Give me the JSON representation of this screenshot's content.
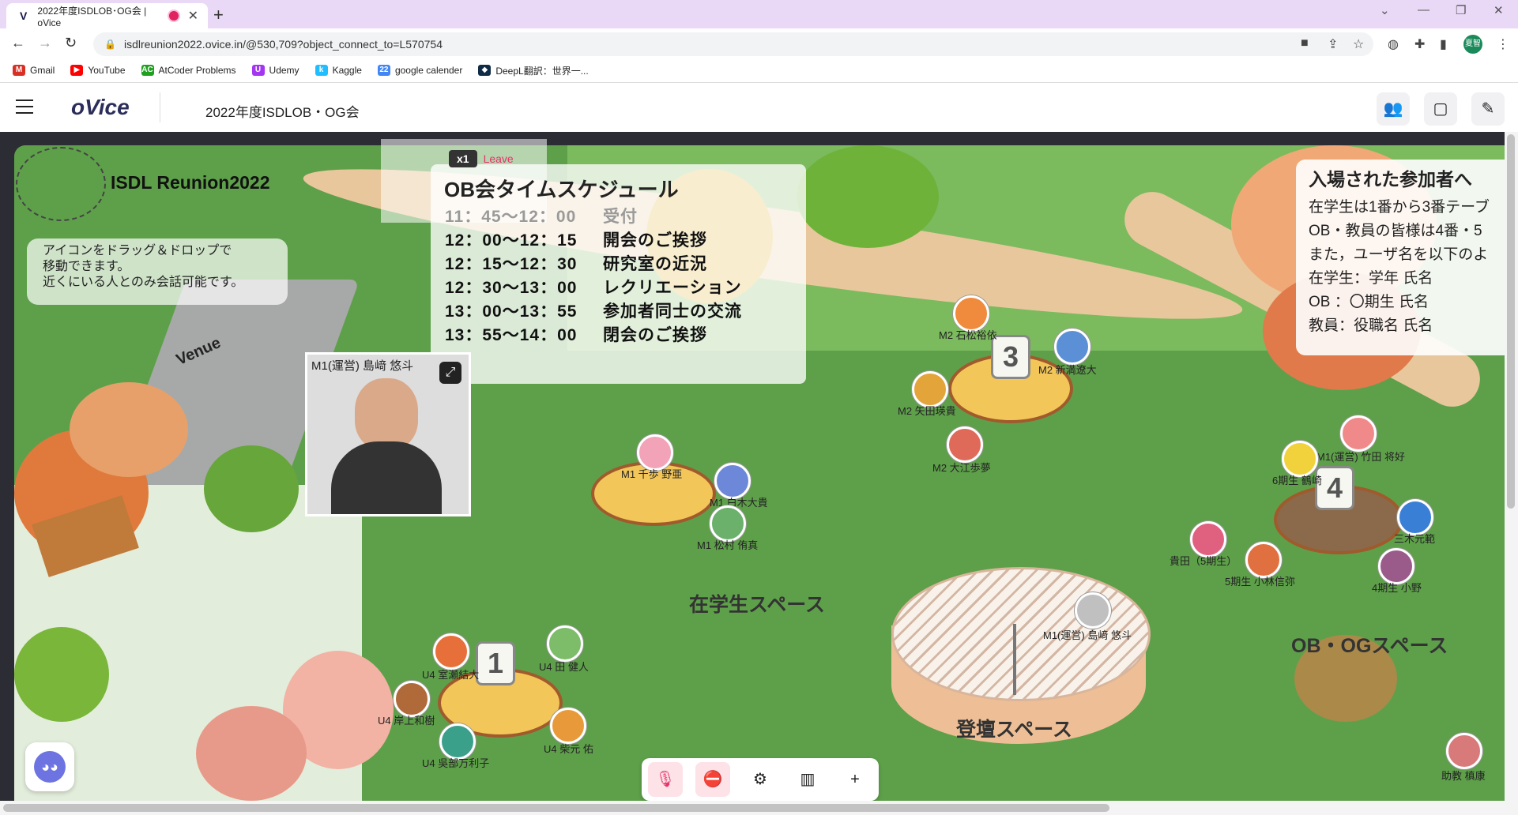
{
  "browser": {
    "tab_title": "2022年度ISDLOB･OG会 | oVice",
    "tab_favicon": "V",
    "new_tab": "+",
    "close_tab": "✕",
    "url": "isdlreunion2022.ovice.in/@530,709?object_connect_to=L570754",
    "bookmarks": [
      {
        "label": "Gmail",
        "icon": "M",
        "color": "#d93025"
      },
      {
        "label": "YouTube",
        "icon": "▶",
        "color": "#ff0000"
      },
      {
        "label": "AtCoder Problems",
        "icon": "AC",
        "color": "#1fa11f"
      },
      {
        "label": "Udemy",
        "icon": "U",
        "color": "#a435f0"
      },
      {
        "label": "Kaggle",
        "icon": "k",
        "color": "#20beff"
      },
      {
        "label": "google calender",
        "icon": "22",
        "color": "#4285f4"
      },
      {
        "label": "DeepL翻訳：世界一...",
        "icon": "◆",
        "color": "#0f2b46"
      }
    ],
    "profile_initials": "夏智"
  },
  "app": {
    "logo": "oVice",
    "room_title": "2022年度ISDLOB・OG会"
  },
  "map": {
    "isdl_title": "ISDL Reunion2022",
    "instructions": [
      "アイコンをドラッグ＆ドロップで",
      "移動できます。",
      "近くにいる人とのみ会話可能です。"
    ],
    "venue_sign": "Venue",
    "zoom": "x1",
    "leave": "Leave",
    "schedule_title": "OB会タイムスケジュール",
    "schedule": [
      {
        "time": "11：45〜12：00",
        "item": "受付"
      },
      {
        "time": "12：00〜12：15",
        "item": "開会のご挨拶"
      },
      {
        "time": "12：15〜12：30",
        "item": "研究室の近況"
      },
      {
        "time": "12：30〜13：00",
        "item": "レクリエーション"
      },
      {
        "time": "13：00〜13：55",
        "item": "参加者同士の交流"
      },
      {
        "time": "13：55〜14：00",
        "item": "閉会のご挨拶"
      }
    ],
    "notice_title": "入場された参加者へ",
    "notice_lines": [
      "在学生は1番から3番テーブ",
      "OB・教員の皆様は4番・5",
      "また，ユーザ名を以下のよ",
      "在学生：学年 氏名",
      "OB ：〇期生 氏名",
      "教員：役職名 氏名"
    ],
    "video_label": "M1(運営) 島﨑 悠斗",
    "space_labels": {
      "students": "在学生スペース",
      "obog": "OB・OGスペース",
      "stage": "登壇スペース"
    },
    "tables": [
      "1",
      "3",
      "4"
    ],
    "users": [
      {
        "name": "M2 石松裕依",
        "color": "#f08a3c"
      },
      {
        "name": "M2 新満遼大",
        "color": "#5b8fd6"
      },
      {
        "name": "M2 矢田瑛貴",
        "color": "#e3a43a"
      },
      {
        "name": "M2 大江歩夢",
        "color": "#e06a5a"
      },
      {
        "name": "M1 千歩 野亜",
        "color": "#f3a3b8"
      },
      {
        "name": "M1 白木大貴",
        "color": "#6d88d8"
      },
      {
        "name": "M1 松村 侑真",
        "color": "#6bb06b"
      },
      {
        "name": "U4 室瀬結大",
        "color": "#e66f3a"
      },
      {
        "name": "U4 田 健人",
        "color": "#7dbd6a"
      },
      {
        "name": "U4 岸上和樹",
        "color": "#b06a3a"
      },
      {
        "name": "U4 柴元 佑",
        "color": "#e89a3a"
      },
      {
        "name": "U4 吳部万利子",
        "color": "#3aa08a"
      },
      {
        "name": "M1(運営) 竹田 将好",
        "color": "#f08a8a"
      },
      {
        "name": "6期生 鶴崎",
        "color": "#f2d23c"
      },
      {
        "name": "三木元範",
        "color": "#3a7fd6"
      },
      {
        "name": "貴田（5期生）",
        "color": "#e06080"
      },
      {
        "name": "5期生 小林信弥",
        "color": "#e07040"
      },
      {
        "name": "4期生 小野",
        "color": "#9a5a8a"
      },
      {
        "name": "M1(運営) 島﨑 悠斗",
        "color": "#c0c0c0"
      },
      {
        "name": "助教 槙康",
        "color": "#d87a7a"
      }
    ]
  },
  "colors": {
    "accent": "#e6336c",
    "logo": "#2b2d5a",
    "grass": "#5ea04a"
  }
}
